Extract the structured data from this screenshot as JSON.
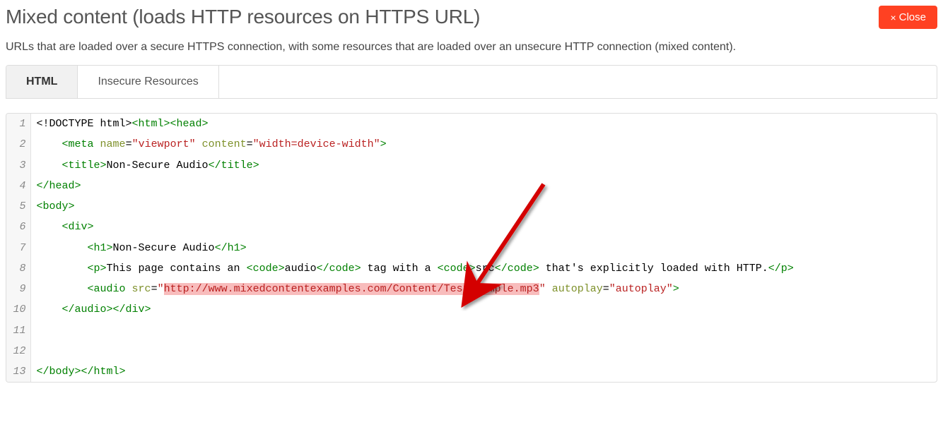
{
  "header": {
    "title": "Mixed content (loads HTTP resources on HTTPS URL)",
    "close_label": "Close"
  },
  "description": "URLs that are loaded over a secure HTTPS connection, with some resources that are loaded over an unsecure HTTP connection (mixed content).",
  "tabs": [
    {
      "label": "HTML",
      "active": true
    },
    {
      "label": "Insecure Resources",
      "active": false
    }
  ],
  "code": {
    "highlight_url": "http://www.mixedcontentexamples.com/Content/Test/sample.mp3",
    "lines": [
      {
        "n": 1,
        "tokens": [
          {
            "c": "tok-text",
            "t": "<!DOCTYPE html>"
          },
          {
            "c": "tok-tag",
            "t": "<html><head>"
          }
        ]
      },
      {
        "n": 2,
        "tokens": [
          {
            "c": "tok-text",
            "t": "    "
          },
          {
            "c": "tok-tag",
            "t": "<meta"
          },
          {
            "c": "tok-text",
            "t": " "
          },
          {
            "c": "tok-attr",
            "t": "name"
          },
          {
            "c": "tok-text",
            "t": "="
          },
          {
            "c": "tok-str",
            "t": "\"viewport\""
          },
          {
            "c": "tok-text",
            "t": " "
          },
          {
            "c": "tok-attr",
            "t": "content"
          },
          {
            "c": "tok-text",
            "t": "="
          },
          {
            "c": "tok-str",
            "t": "\"width=device-width\""
          },
          {
            "c": "tok-tag",
            "t": ">"
          }
        ]
      },
      {
        "n": 3,
        "tokens": [
          {
            "c": "tok-text",
            "t": "    "
          },
          {
            "c": "tok-tag",
            "t": "<title>"
          },
          {
            "c": "tok-text",
            "t": "Non-Secure Audio"
          },
          {
            "c": "tok-tag",
            "t": "</title>"
          }
        ]
      },
      {
        "n": 4,
        "tokens": [
          {
            "c": "tok-tag",
            "t": "</head>"
          }
        ]
      },
      {
        "n": 5,
        "tokens": [
          {
            "c": "tok-tag",
            "t": "<body>"
          }
        ]
      },
      {
        "n": 6,
        "tokens": [
          {
            "c": "tok-text",
            "t": "    "
          },
          {
            "c": "tok-tag",
            "t": "<div>"
          }
        ]
      },
      {
        "n": 7,
        "tokens": [
          {
            "c": "tok-text",
            "t": "        "
          },
          {
            "c": "tok-tag",
            "t": "<h1>"
          },
          {
            "c": "tok-text",
            "t": "Non-Secure Audio"
          },
          {
            "c": "tok-tag",
            "t": "</h1>"
          }
        ]
      },
      {
        "n": 8,
        "tokens": [
          {
            "c": "tok-text",
            "t": "        "
          },
          {
            "c": "tok-tag",
            "t": "<p>"
          },
          {
            "c": "tok-text",
            "t": "This page contains an "
          },
          {
            "c": "tok-tag",
            "t": "<code>"
          },
          {
            "c": "tok-text",
            "t": "audio"
          },
          {
            "c": "tok-tag",
            "t": "</code>"
          },
          {
            "c": "tok-text",
            "t": " tag with a "
          },
          {
            "c": "tok-tag",
            "t": "<code>"
          },
          {
            "c": "tok-text",
            "t": "src"
          },
          {
            "c": "tok-tag",
            "t": "</code>"
          },
          {
            "c": "tok-text",
            "t": " that's explicitly loaded with HTTP."
          },
          {
            "c": "tok-tag",
            "t": "</p>"
          }
        ]
      },
      {
        "n": 9,
        "tokens": [
          {
            "c": "tok-text",
            "t": "        "
          },
          {
            "c": "tok-tag",
            "t": "<audio"
          },
          {
            "c": "tok-text",
            "t": " "
          },
          {
            "c": "tok-attr",
            "t": "src"
          },
          {
            "c": "tok-text",
            "t": "="
          },
          {
            "c": "tok-str",
            "t": "\""
          },
          {
            "c": "tok-str hl",
            "t": "http://www.mixedcontentexamples.com/Content/Test/sample.mp3"
          },
          {
            "c": "tok-str",
            "t": "\""
          },
          {
            "c": "tok-text",
            "t": " "
          },
          {
            "c": "tok-attr",
            "t": "autoplay"
          },
          {
            "c": "tok-text",
            "t": "="
          },
          {
            "c": "tok-str",
            "t": "\"autoplay\""
          },
          {
            "c": "tok-tag",
            "t": ">"
          }
        ]
      },
      {
        "n": 10,
        "tokens": [
          {
            "c": "tok-text",
            "t": "    "
          },
          {
            "c": "tok-tag",
            "t": "</audio></div>"
          }
        ]
      },
      {
        "n": 11,
        "tokens": []
      },
      {
        "n": 12,
        "tokens": []
      },
      {
        "n": 13,
        "tokens": [
          {
            "c": "tok-tag",
            "t": "</body></html>"
          }
        ]
      }
    ]
  }
}
